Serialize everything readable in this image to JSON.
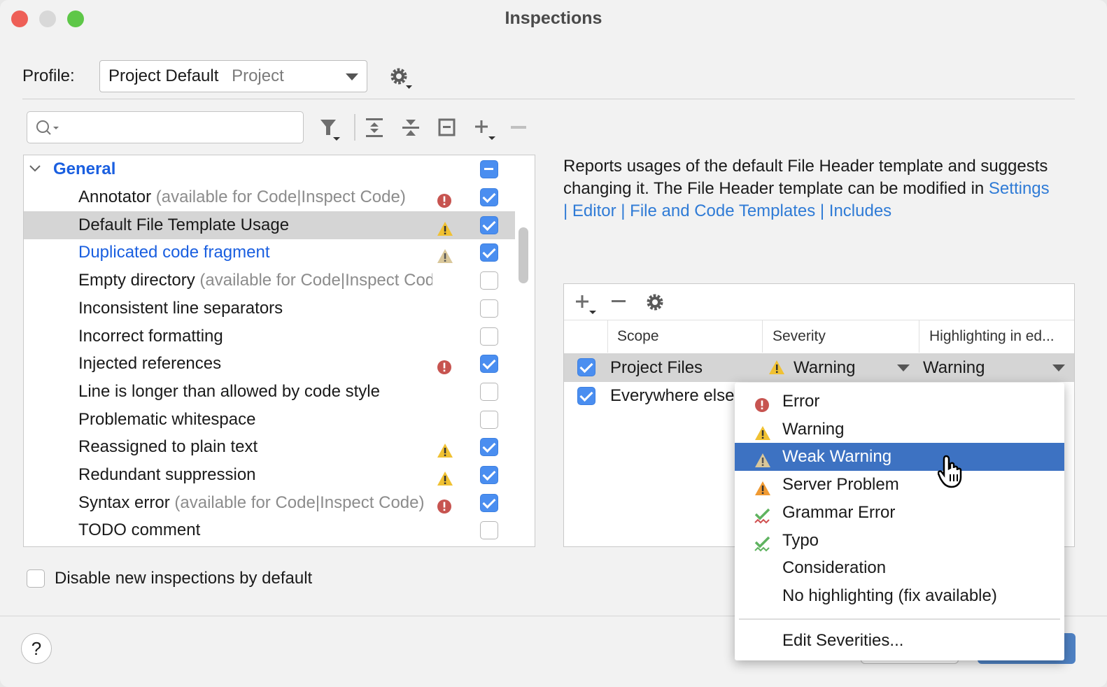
{
  "window": {
    "title": "Inspections"
  },
  "profile": {
    "label": "Profile:",
    "value": "Project Default",
    "scope": "Project"
  },
  "search": {
    "placeholder": ""
  },
  "toolbar": {
    "icons": [
      "filter-icon",
      "expand-all-icon",
      "collapse-all-icon",
      "reset-icon",
      "add-icon",
      "remove-icon"
    ]
  },
  "tree": {
    "group": "General",
    "items": [
      {
        "label": "Annotator",
        "note": "(available for Code|Inspect Code)",
        "severity": "error",
        "checked": true,
        "selected": false,
        "link": false
      },
      {
        "label": "Default File Template Usage",
        "note": "",
        "severity": "warning",
        "checked": true,
        "selected": true,
        "link": false
      },
      {
        "label": "Duplicated code fragment",
        "note": "",
        "severity": "weak-warning",
        "checked": true,
        "selected": false,
        "link": true
      },
      {
        "label": "Empty directory",
        "note": "(available for Code|Inspect Code)",
        "severity": "",
        "checked": false,
        "selected": false,
        "link": false
      },
      {
        "label": "Inconsistent line separators",
        "note": "",
        "severity": "",
        "checked": false,
        "selected": false,
        "link": false
      },
      {
        "label": "Incorrect formatting",
        "note": "",
        "severity": "",
        "checked": false,
        "selected": false,
        "link": false
      },
      {
        "label": "Injected references",
        "note": "",
        "severity": "error",
        "checked": true,
        "selected": false,
        "link": false
      },
      {
        "label": "Line is longer than allowed by code style",
        "note": "",
        "severity": "",
        "checked": false,
        "selected": false,
        "link": false
      },
      {
        "label": "Problematic whitespace",
        "note": "",
        "severity": "",
        "checked": false,
        "selected": false,
        "link": false
      },
      {
        "label": "Reassigned to plain text",
        "note": "",
        "severity": "warning",
        "checked": true,
        "selected": false,
        "link": false
      },
      {
        "label": "Redundant suppression",
        "note": "",
        "severity": "warning",
        "checked": true,
        "selected": false,
        "link": false
      },
      {
        "label": "Syntax error",
        "note": "(available for Code|Inspect Code)",
        "severity": "error",
        "checked": true,
        "selected": false,
        "link": false
      },
      {
        "label": "TODO comment",
        "note": "",
        "severity": "",
        "checked": false,
        "selected": false,
        "link": false
      }
    ]
  },
  "disable_new": {
    "label": "Disable new inspections by default",
    "checked": false
  },
  "description": {
    "text": "Reports usages of the default File Header template and suggests changing it. The File Header template can be modified in ",
    "link": "Settings | Editor | File and Code Templates | Includes"
  },
  "scopes_table": {
    "headers": [
      "Scope",
      "Severity",
      "Highlighting in ed..."
    ],
    "rows": [
      {
        "scope": "Project Files",
        "severity": "Warning",
        "highlighting": "Warning",
        "checked": true
      },
      {
        "scope": "Everywhere else",
        "checked": true
      }
    ]
  },
  "severity_menu": {
    "items": [
      {
        "label": "Error",
        "icon": "error"
      },
      {
        "label": "Warning",
        "icon": "warning"
      },
      {
        "label": "Weak Warning",
        "icon": "weak-warning",
        "highlighted": true
      },
      {
        "label": "Server Problem",
        "icon": "server-problem"
      },
      {
        "label": "Grammar Error",
        "icon": "grammar"
      },
      {
        "label": "Typo",
        "icon": "typo"
      },
      {
        "label": "Consideration",
        "icon": ""
      },
      {
        "label": "No highlighting (fix available)",
        "icon": ""
      }
    ],
    "edit": "Edit Severities..."
  },
  "help": {
    "label": "?"
  },
  "colors": {
    "accent": "#4a8ef0",
    "highlight": "#3d72c2",
    "link": "#2f7bd6",
    "error": "#c75450",
    "warning": "#f0c132"
  }
}
